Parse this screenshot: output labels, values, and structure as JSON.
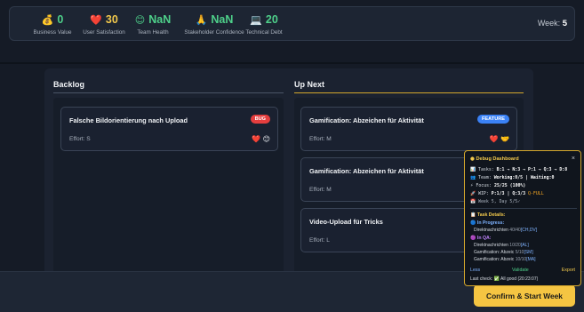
{
  "metrics": [
    {
      "icon": "💰",
      "value": "0",
      "label": "Business Value",
      "color": "green"
    },
    {
      "icon": "❤️",
      "value": "30",
      "label": "User Satisfaction",
      "color": "yellow"
    },
    {
      "icon": "😊",
      "value": "NaN",
      "label": "Team Health",
      "color": "green"
    },
    {
      "icon": "🙏",
      "value": "NaN",
      "label": "Stakeholder Confidence",
      "color": "green"
    },
    {
      "icon": "💻",
      "value": "20",
      "label": "Technical Debt",
      "color": "green"
    }
  ],
  "week": {
    "label": "Week:",
    "value": "5"
  },
  "backlog": {
    "title": "Backlog",
    "cards": [
      {
        "title": "Falsche Bildorientierung nach Upload",
        "tag": "BUG",
        "effort": "Effort: S",
        "icons": "❤️ 😊"
      }
    ]
  },
  "up_next": {
    "title": "Up Next",
    "cards": [
      {
        "title": "Gamification: Abzeichen für Aktivität",
        "tag": "FEATURE",
        "effort": "Effort: M",
        "icons": "❤️ 🤝"
      },
      {
        "title": "Gamification: Abzeichen für Aktivität",
        "effort": "Effort: M"
      },
      {
        "title": "Video-Upload für Tricks",
        "effort": "Effort: L"
      }
    ]
  },
  "confirm_label": "Confirm & Start Week",
  "debug": {
    "title": "Debug Dashboard",
    "close": "×",
    "tasks": {
      "icon": "📊",
      "label": "Tasks:",
      "value": "B:1 → N:3 → P:1 → Q:3 → D:8"
    },
    "team": {
      "icon": "👥",
      "label": "Team:",
      "value": "Working:0/5 | Waiting:0"
    },
    "focus": {
      "icon": "⚡",
      "label": "Focus:",
      "value": "25/25 (100%)"
    },
    "wip": {
      "icon": "🚀",
      "label": "WIP:",
      "value": "P:1/3 | Q:3/3",
      "flag": "Q-FULL"
    },
    "week_day": {
      "icon": "📅",
      "text": "Week 5, Day 5/5✓"
    },
    "details_title": "Task Details:",
    "details_icon": "📋",
    "in_progress": {
      "icon": "🔵",
      "label": "In Progress:",
      "items": [
        {
          "name": "Direktnachrichten",
          "num": "40/40",
          "who": "[CH,DV]"
        }
      ]
    },
    "in_qa": {
      "icon": "🟣",
      "label": "In QA:",
      "items": [
        {
          "name": "Direktnachrichten",
          "num": "10/20",
          "who": "[AL]"
        },
        {
          "name": "Gamification: Abzeic",
          "num": "5/10",
          "who": "[SM]"
        },
        {
          "name": "Gamification: Abzeic",
          "num": "10/10",
          "who": "[MA]"
        }
      ]
    },
    "less": "Less",
    "validate": "Validate",
    "export": "Export",
    "last_check": "Last check: ✅ All good (20:23:07)"
  }
}
